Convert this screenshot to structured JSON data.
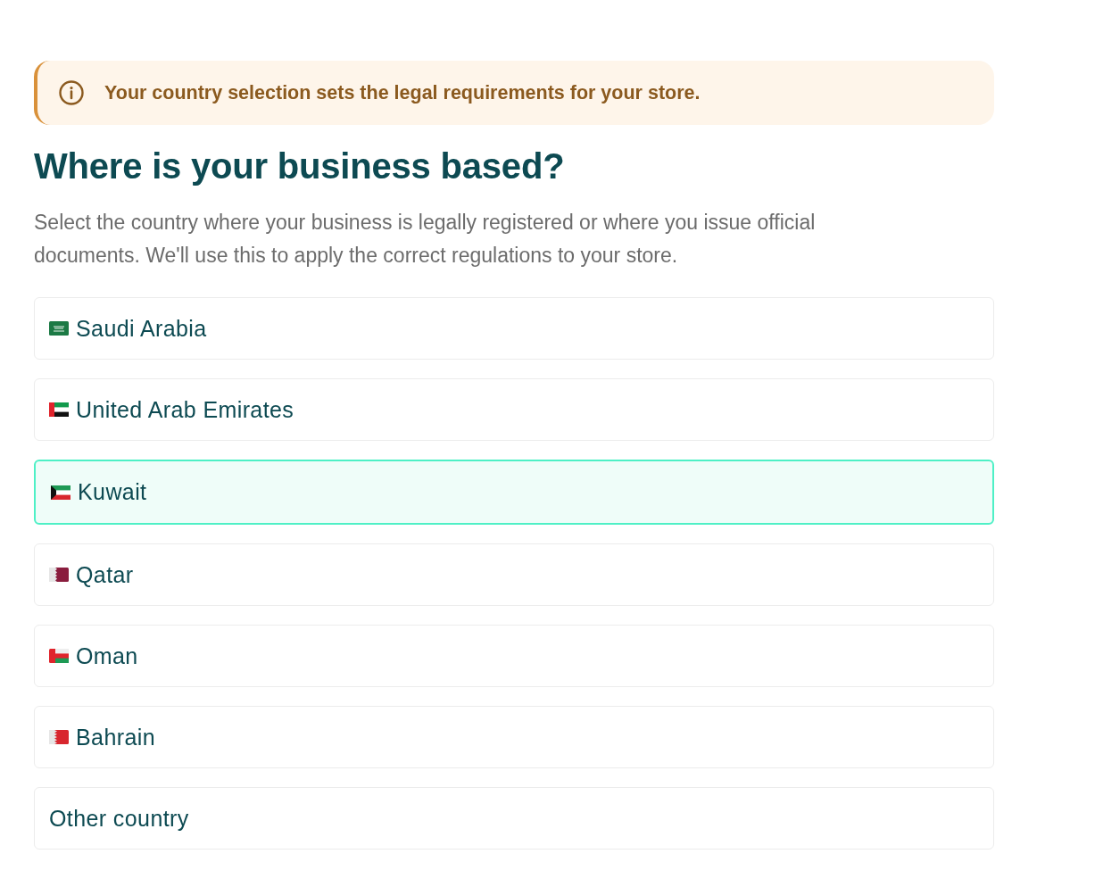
{
  "notice": {
    "text": "Your country selection sets the legal requirements for your store."
  },
  "heading": "Where is your business based?",
  "description": "Select the country where your business is legally registered or where you issue official documents. We'll use this to apply the correct regulations to your store.",
  "options": [
    {
      "label": "Saudi Arabia",
      "kind": "saudi",
      "selected": false
    },
    {
      "label": "United Arab Emirates",
      "kind": "emirates",
      "selected": false
    },
    {
      "label": "Kuwait",
      "kind": "kuwait",
      "selected": true
    },
    {
      "label": "Qatar",
      "kind": "qatar",
      "selected": false
    },
    {
      "label": "Oman",
      "kind": "oman",
      "selected": false
    },
    {
      "label": "Bahrain",
      "kind": "bahrain",
      "selected": false
    },
    {
      "label": "Other country",
      "kind": "plain",
      "selected": false
    }
  ]
}
